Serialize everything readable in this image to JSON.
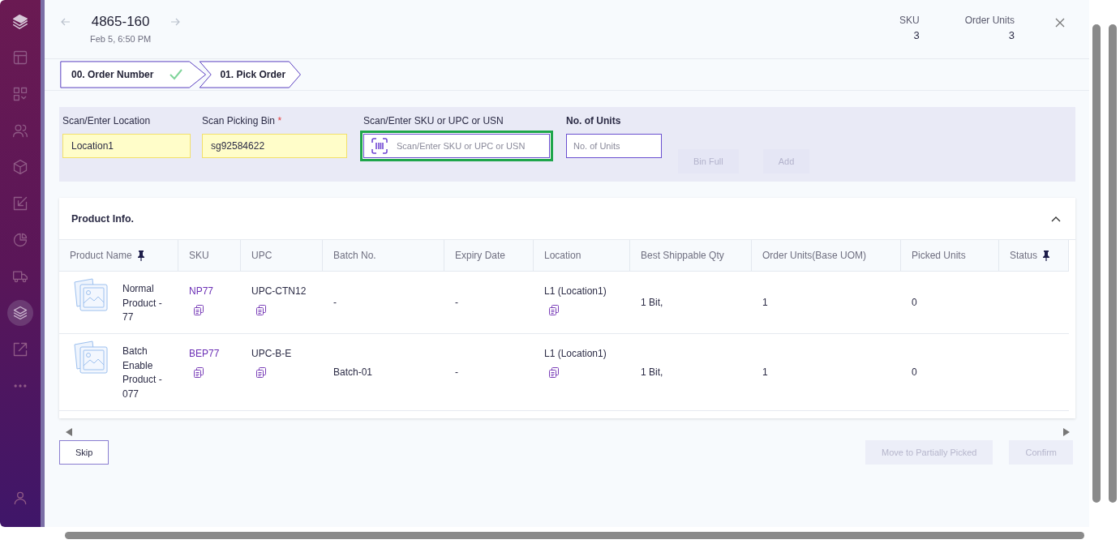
{
  "sidebar": {
    "items": [
      {
        "kind": "logo",
        "selected": false
      },
      {
        "kind": "layout",
        "selected": false
      },
      {
        "kind": "grid",
        "selected": false
      },
      {
        "kind": "users",
        "selected": false
      },
      {
        "kind": "box",
        "selected": false
      },
      {
        "kind": "inbound",
        "selected": false
      },
      {
        "kind": "chart",
        "selected": false
      },
      {
        "kind": "truck",
        "selected": false
      },
      {
        "kind": "layers",
        "selected": true
      },
      {
        "kind": "outbound",
        "selected": false
      },
      {
        "kind": "more",
        "selected": false
      }
    ],
    "footer_items": [
      {
        "kind": "user",
        "selected": false
      }
    ]
  },
  "header": {
    "title": "4865-160",
    "date": "Feb 5, 6:50 PM",
    "stats": [
      {
        "label": "SKU",
        "value": "3"
      },
      {
        "label": "Order Units",
        "value": "3"
      }
    ]
  },
  "steps": [
    {
      "label": "00. Order Number",
      "completed": true
    },
    {
      "label": "01. Pick Order",
      "completed": false
    }
  ],
  "form": {
    "fields": [
      {
        "kind": "text",
        "label": "Scan/Enter Location",
        "value": "Location1",
        "filled": true,
        "focused": false
      },
      {
        "kind": "text",
        "label": "Scan Picking Bin",
        "required_mark": "*",
        "value": "sg92584622",
        "filled": true,
        "focused": false
      },
      {
        "kind": "scan",
        "label": "Scan/Enter SKU or UPC or USN",
        "placeholder": "Scan/Enter SKU or UPC or USN",
        "filled": false,
        "focused": true
      },
      {
        "kind": "number",
        "label": "No. of Units",
        "placeholder": "No. of Units",
        "filled": false,
        "focused": false
      }
    ],
    "buttons": [
      {
        "label": "Bin Full",
        "disabled": true
      },
      {
        "label": "Add",
        "disabled": true
      }
    ]
  },
  "product_info": {
    "title": "Product Info.",
    "expanded": true,
    "columns": [
      {
        "label": "Product Name",
        "pinned": true
      },
      {
        "label": "SKU",
        "pinned": false
      },
      {
        "label": "UPC",
        "pinned": false
      },
      {
        "label": "Batch No.",
        "pinned": false
      },
      {
        "label": "Expiry Date",
        "pinned": false
      },
      {
        "label": "Location",
        "pinned": false
      },
      {
        "label": "Best Shippable Qty",
        "pinned": false
      },
      {
        "label": "Order Units(Base UOM)",
        "pinned": false
      },
      {
        "label": "Picked Units",
        "pinned": false
      },
      {
        "label": "Status",
        "pinned": true
      }
    ],
    "rows": [
      {
        "product_name": "Normal Product - 77",
        "sku": "NP77",
        "upc": "UPC-CTN12",
        "batch_no": "-",
        "expiry_date": "-",
        "location": "L1 (Location1)",
        "best_shippable_qty": "1 Bit,",
        "order_units": "1",
        "picked_units": "0"
      },
      {
        "product_name": "Batch Enable Product - 077",
        "sku": "BEP77",
        "upc": "UPC-B-E",
        "batch_no": "Batch-01",
        "expiry_date": "-",
        "location": "L1 (Location1)",
        "best_shippable_qty": "1 Bit,",
        "order_units": "1",
        "picked_units": "0"
      }
    ]
  },
  "footer": {
    "left_buttons": [
      {
        "label": "Skip",
        "disabled": false
      }
    ],
    "right_buttons": [
      {
        "label": "Move to Partially Picked",
        "disabled": true
      },
      {
        "label": "Confirm",
        "disabled": true
      }
    ]
  }
}
